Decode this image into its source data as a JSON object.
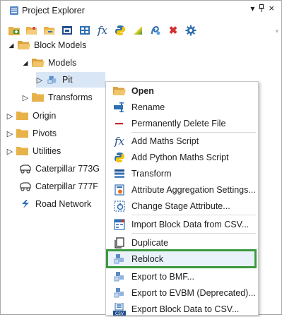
{
  "window": {
    "title": "Project Explorer",
    "pin_glyph": "▾",
    "dock_glyph": "ᵖ",
    "close_glyph": "×"
  },
  "toolbar": {
    "buttons": [
      "new-folder-icon",
      "open-folder-icon",
      "folder-go-icon",
      "window-icon",
      "table-icon",
      "fx-icon",
      "python-icon",
      "gradient-icon",
      "curve-icon",
      "close-icon",
      "gear-icon"
    ],
    "overflow": "▾"
  },
  "tree": {
    "block_models": "Block Models",
    "models": "Models",
    "pit": "Pit",
    "transforms": "Transforms",
    "origin": "Origin",
    "pivots": "Pivots",
    "utilities": "Utilities",
    "cat773": "Caterpillar 773G",
    "cat777": "Caterpillar 777F",
    "road": "Road Network"
  },
  "menu": {
    "open": "Open",
    "rename": "Rename",
    "delete": "Permanently Delete File",
    "add_maths": "Add Maths Script",
    "add_python": "Add Python Maths Script",
    "transform": "Transform",
    "aggregation": "Attribute Aggregation Settings...",
    "stage": "Change Stage Attribute...",
    "import_csv": "Import Block Data from CSV...",
    "duplicate": "Duplicate",
    "reblock": "Reblock",
    "export_bmf": "Export to BMF...",
    "export_evbm": "Export to EVBM (Deprecated)...",
    "export_csv": "Export Block Data to CSV..."
  },
  "colors": {
    "folder": "#e8b24a",
    "selection": "#d9e6f5",
    "reblock_outline": "#3c9a3e",
    "accent_blue": "#2f6fb3"
  }
}
